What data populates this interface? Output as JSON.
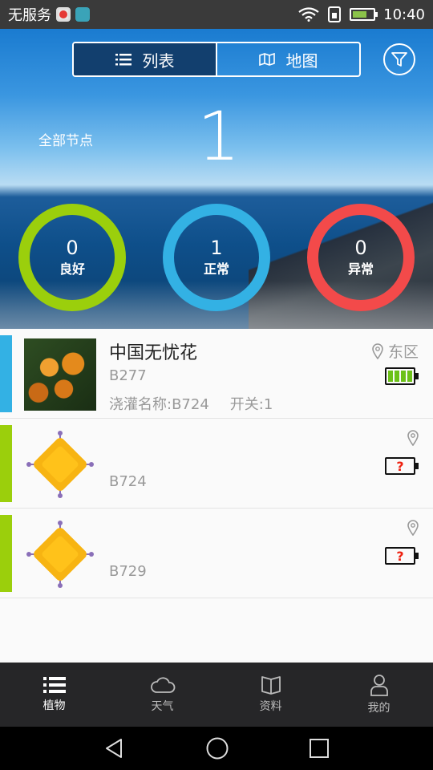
{
  "status_bar": {
    "carrier": "无服务",
    "time": "10:40"
  },
  "header": {
    "tabs": [
      {
        "label": "列表",
        "icon": "list-icon",
        "active": true
      },
      {
        "label": "地图",
        "icon": "map-icon",
        "active": false
      }
    ],
    "filter_icon": "filter-icon"
  },
  "summary": {
    "all_label": "全部节点",
    "all_count": "1",
    "rings": [
      {
        "count": "0",
        "label": "良好",
        "color": "#9bcf0c"
      },
      {
        "count": "1",
        "label": "正常",
        "color": "#33b1e4"
      },
      {
        "count": "0",
        "label": "异常",
        "color": "#f34a4a"
      }
    ]
  },
  "nodes": [
    {
      "name": "中国无忧花",
      "code": "B277",
      "irrigation": "浇灌名称:B724",
      "switch": "开关:1",
      "location": "东区",
      "battery": "full",
      "status_color": "#33b1e4",
      "thumb": "plant-photo"
    },
    {
      "name": "",
      "code": "B724",
      "location": "",
      "battery": "unknown",
      "status_color": "#9bcf0c",
      "thumb": "sensor-icon"
    },
    {
      "name": "",
      "code": "B729",
      "location": "",
      "battery": "unknown",
      "status_color": "#9bcf0c",
      "thumb": "sensor-icon"
    }
  ],
  "battery_unknown_mark": "?",
  "nav": [
    {
      "label": "植物",
      "icon": "list-icon",
      "active": true
    },
    {
      "label": "天气",
      "icon": "cloud-icon",
      "active": false
    },
    {
      "label": "资料",
      "icon": "book-icon",
      "active": false
    },
    {
      "label": "我的",
      "icon": "user-icon",
      "active": false
    }
  ],
  "system_nav": [
    "back-icon",
    "home-icon",
    "recents-icon"
  ]
}
